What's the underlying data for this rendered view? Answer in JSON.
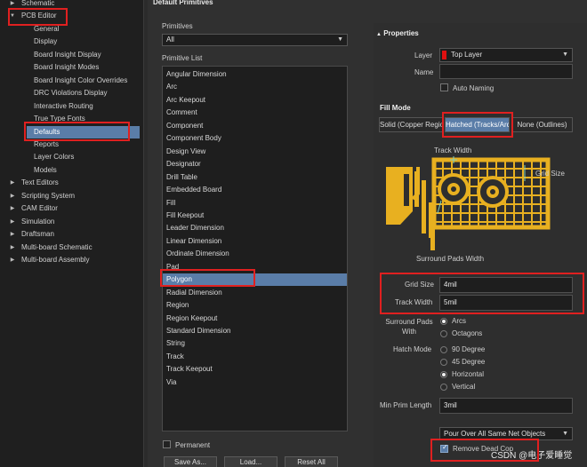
{
  "tree": {
    "items": [
      {
        "label": "Schematic",
        "level": 0,
        "arrow": "right"
      },
      {
        "label": "PCB Editor",
        "level": 0,
        "arrow": "down"
      },
      {
        "label": "General",
        "level": 1
      },
      {
        "label": "Display",
        "level": 1
      },
      {
        "label": "Board Insight Display",
        "level": 1
      },
      {
        "label": "Board Insight Modes",
        "level": 1
      },
      {
        "label": "Board Insight Color Overrides",
        "level": 1
      },
      {
        "label": "DRC Violations Display",
        "level": 1
      },
      {
        "label": "Interactive Routing",
        "level": 1
      },
      {
        "label": "True Type Fonts",
        "level": 1
      },
      {
        "label": "Defaults",
        "level": 1,
        "selected": true
      },
      {
        "label": "Reports",
        "level": 1
      },
      {
        "label": "Layer Colors",
        "level": 1
      },
      {
        "label": "Models",
        "level": 1
      },
      {
        "label": "Text Editors",
        "level": 0,
        "arrow": "right"
      },
      {
        "label": "Scripting System",
        "level": 0,
        "arrow": "right"
      },
      {
        "label": "CAM Editor",
        "level": 0,
        "arrow": "right"
      },
      {
        "label": "Simulation",
        "level": 0,
        "arrow": "right"
      },
      {
        "label": "Draftsman",
        "level": 0,
        "arrow": "right"
      },
      {
        "label": "Multi-board Schematic",
        "level": 0,
        "arrow": "right"
      },
      {
        "label": "Multi-board Assembly",
        "level": 0,
        "arrow": "right"
      }
    ]
  },
  "main": {
    "title": "Default Primitives",
    "primitives_label": "Primitives",
    "primitives_value": "All",
    "list_label": "Primitive List",
    "list": [
      "Angular Dimension",
      "Arc",
      "Arc Keepout",
      "Comment",
      "Component",
      "Component Body",
      "Design View",
      "Designator",
      "Drill Table",
      "Embedded Board",
      "Fill",
      "Fill Keepout",
      "Leader Dimension",
      "Linear Dimension",
      "Ordinate Dimension",
      "Pad",
      "Polygon",
      "Radial Dimension",
      "Region",
      "Region Keepout",
      "Standard Dimension",
      "String",
      "Track",
      "Track Keepout",
      "Via"
    ],
    "selected_index": 16,
    "permanent_label": "Permanent",
    "buttons": [
      "Save As...",
      "Load...",
      "Reset All"
    ]
  },
  "props": {
    "title": "Properties",
    "layer_label": "Layer",
    "layer_value": "Top Layer",
    "layer_color": "#e01010",
    "name_label": "Name",
    "name_value": "",
    "auto_naming": "Auto Naming",
    "fill_mode_label": "Fill Mode",
    "fill_modes": [
      "Solid (Copper Regio",
      "Hatched (Tracks/Arc",
      "None (Outlines)"
    ],
    "fill_mode_selected": 1,
    "diagram": {
      "track_width": "Track Width",
      "grid_size": "Grid Size",
      "surround": "Surround Pads Width"
    },
    "grid_size_label": "Grid Size",
    "grid_size_value": "4mil",
    "track_width_label": "Track Width",
    "track_width_value": "5mil",
    "surround_label": "Surround Pads With",
    "surround_options": [
      "Arcs",
      "Octagons"
    ],
    "surround_selected": 0,
    "hatch_label": "Hatch Mode",
    "hatch_options": [
      "90 Degree",
      "45 Degree",
      "Horizontal",
      "Vertical"
    ],
    "hatch_selected": 2,
    "min_prim_label": "Min Prim Length",
    "min_prim_value": "3mil",
    "pour_value": "Pour Over All Same Net Objects",
    "remove_dead": "Remove Dead Cop",
    "watermark": "CSDN @电子爱睡觉",
    "accent": "#5a7da8",
    "copper_color": "#e8b020"
  }
}
